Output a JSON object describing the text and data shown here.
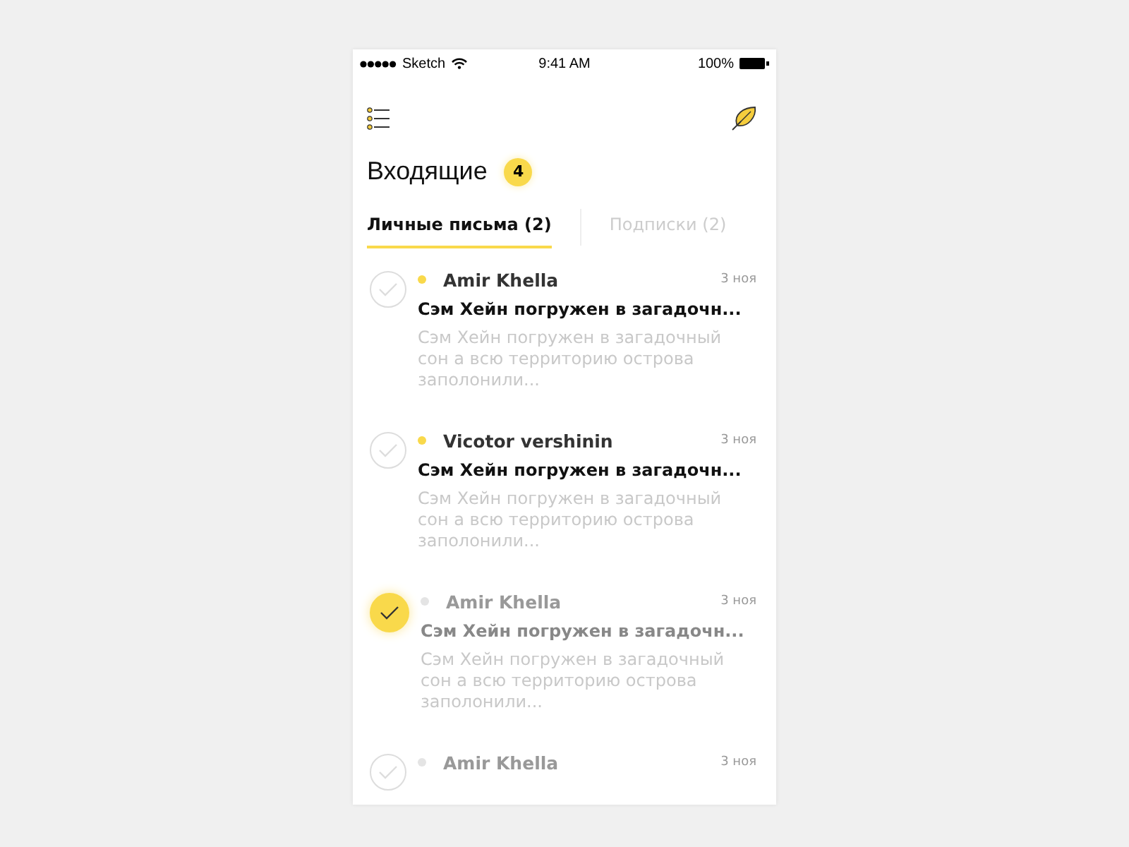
{
  "status_bar": {
    "carrier": "Sketch",
    "time": "9:41 AM",
    "battery": "100%"
  },
  "title": "Входящие",
  "unread_count": "4",
  "tabs": [
    {
      "label": "Личные письма (2)",
      "selected": true
    },
    {
      "label": "Подписки (2)",
      "selected": false
    }
  ],
  "messages": [
    {
      "sender": "Amir Khella",
      "date": "3 ноя",
      "subject": "Сэм Хейн погружен в загадочн...",
      "preview": "Сэм Хейн погружен в загадочный сон а всю территорию острова заполонили...",
      "unread": true,
      "checked": false
    },
    {
      "sender": "Vicotor vershinin",
      "date": "3 ноя",
      "subject": "Сэм Хейн погружен в загадочн...",
      "preview": "Сэм Хейн погружен в загадочный сон а всю территорию острова заполонили...",
      "unread": true,
      "checked": false
    },
    {
      "sender": "Amir Khella",
      "date": "3 ноя",
      "subject": "Сэм Хейн погружен в загадочн...",
      "preview": "Сэм Хейн погружен в загадочный сон а всю территорию острова заполонили...",
      "unread": false,
      "checked": true
    },
    {
      "sender": "Amir Khella",
      "date": "3 ноя",
      "unread": false,
      "checked": false
    }
  ]
}
